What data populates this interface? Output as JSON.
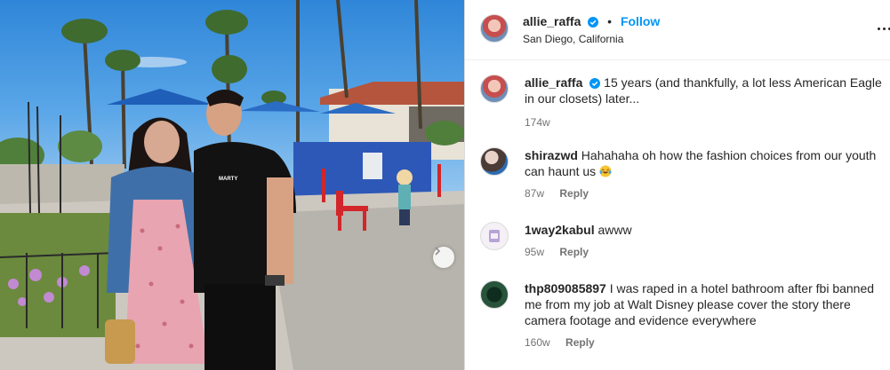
{
  "post": {
    "username": "allie_raffa",
    "follow_label": "Follow",
    "location": "San Diego, California",
    "caption_user": "allie_raffa",
    "caption": "15 years (and thankfully, a lot less American Eagle in our closets) later...",
    "caption_age": "174w"
  },
  "photo": {
    "shirt_text": "MARTY"
  },
  "comments": [
    {
      "user": "shirazwd",
      "text": "Hahahaha oh how the fashion choices from our youth can haunt us",
      "emoji": "laughing-tears",
      "age": "87w",
      "reply_label": "Reply"
    },
    {
      "user": "1way2kabul",
      "text": "awww",
      "age": "95w",
      "reply_label": "Reply"
    },
    {
      "user": "thp809085897",
      "text": "I was raped in a hotel bathroom after fbi banned me from my job at Walt Disney please cover the story there camera footage and evidence everywhere",
      "age": "160w",
      "reply_label": "Reply"
    }
  ],
  "colors": {
    "accent": "#0095f6",
    "text": "#262626",
    "muted": "#737373"
  }
}
